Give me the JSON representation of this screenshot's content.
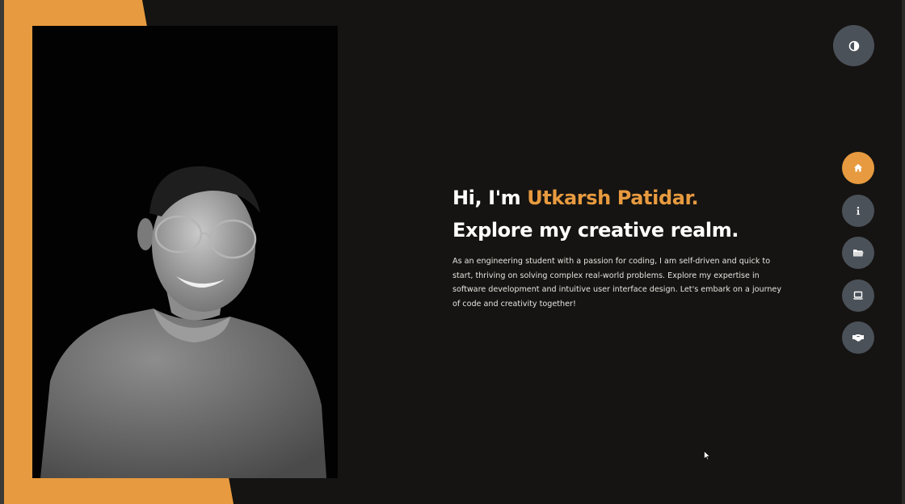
{
  "hero": {
    "greeting": "Hi, I'm ",
    "name": "Utkarsh Patidar.",
    "subtitle": "Explore my creative realm.",
    "description": "As an engineering student with a passion for coding, I am self-driven and quick to start, thriving on solving complex real-world problems. Explore my expertise in software development and intuitive user interface design. Let's embark on a journey of code and creativity together!"
  },
  "theme_toggle": {
    "icon": "contrast-icon"
  },
  "nav": {
    "items": [
      {
        "icon": "home-icon",
        "active": true
      },
      {
        "icon": "info-icon",
        "active": false
      },
      {
        "icon": "folder-icon",
        "active": false
      },
      {
        "icon": "laptop-icon",
        "active": false
      },
      {
        "icon": "handshake-icon",
        "active": false
      }
    ]
  },
  "colors": {
    "accent": "#e79a3f",
    "background": "#151412",
    "button": "#4b5159",
    "text": "#ffffff"
  }
}
